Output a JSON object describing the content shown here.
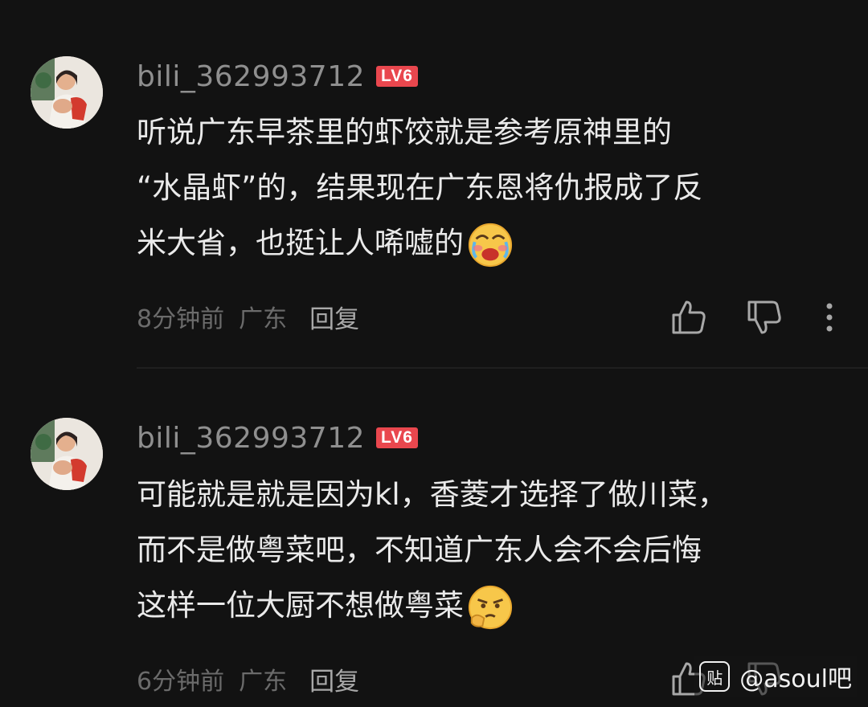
{
  "comments": [
    {
      "username": "bili_362993712",
      "level": "LV6",
      "lines": [
        "听说广东早茶里的虾饺就是参考原神里的",
        "“水晶虾”的，结果现在广东恩将仇报成了反",
        "米大省，也挺让人唏嘘的"
      ],
      "emoji": "crying-face-emoji",
      "time": "8分钟前",
      "location": "广东",
      "reply_label": "回复"
    },
    {
      "username": "bili_362993712",
      "level": "LV6",
      "lines": [
        "可能就是就是因为kl，香菱才选择了做川菜，",
        "而不是做粤菜吧，不知道广东人会不会后悔",
        "这样一位大厨不想做粤菜"
      ],
      "emoji": "thinking-face-emoji",
      "time": "6分钟前",
      "location": "广东",
      "reply_label": "回复"
    }
  ],
  "watermark": {
    "logo": "贴",
    "text": "@asoul吧"
  },
  "colors": {
    "background": "#121212",
    "level_badge": "#e9474e",
    "username": "#8f8f8f",
    "text": "#eaeaea"
  }
}
